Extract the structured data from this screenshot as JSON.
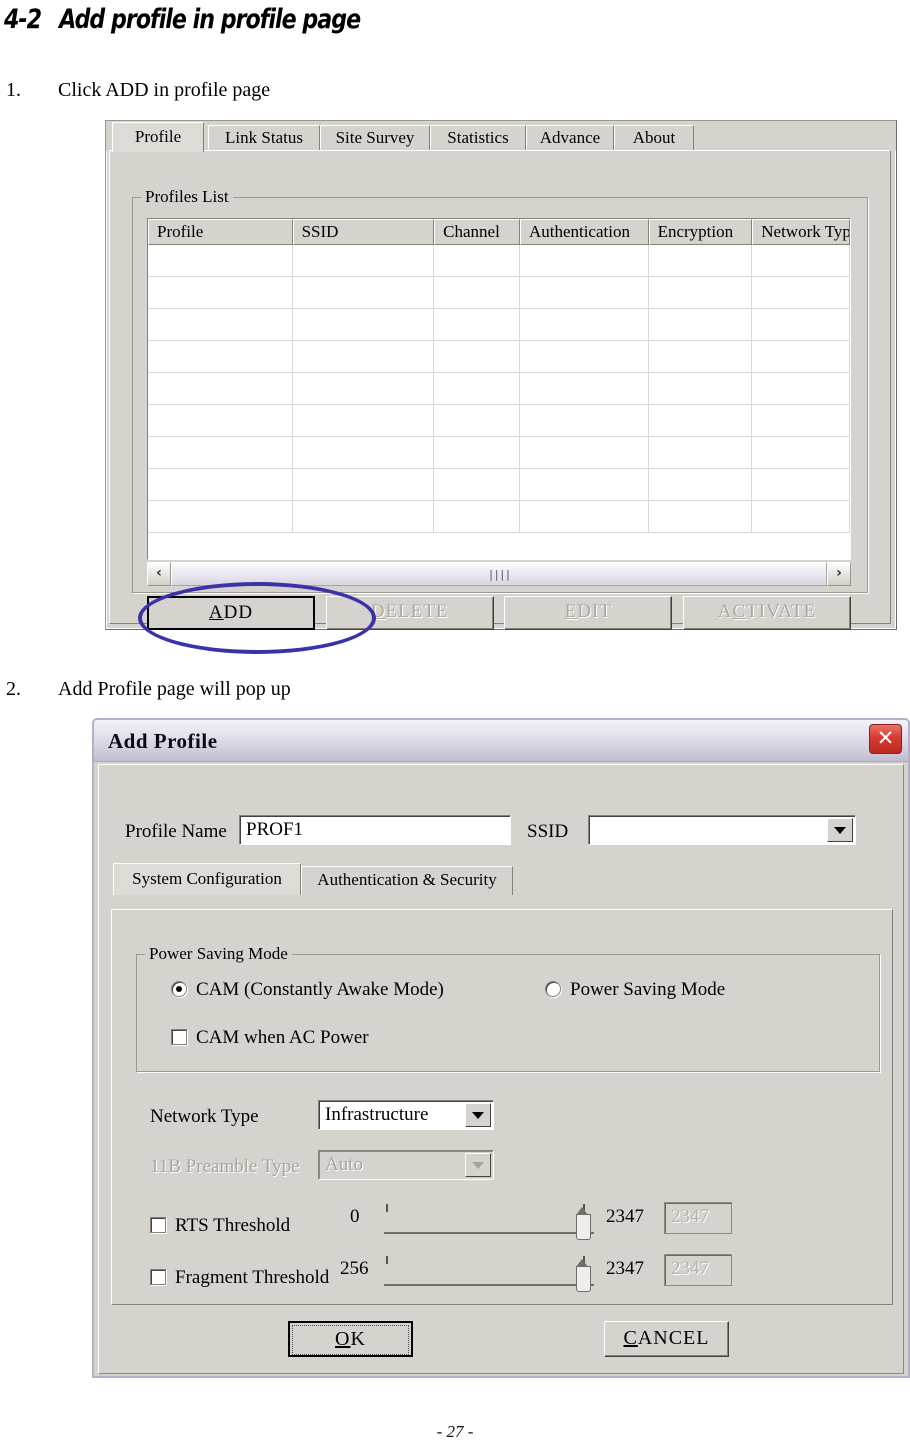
{
  "document": {
    "section_number": "4-2",
    "section_title": "Add profile in profile page",
    "steps": [
      {
        "num": "1.",
        "text": "Click ADD in profile page"
      },
      {
        "num": "2.",
        "text": "Add Profile page will pop up"
      }
    ],
    "page_footer": "- 27 -"
  },
  "profile_window": {
    "tabs": [
      {
        "label": "Profile",
        "selected": true
      },
      {
        "label": "Link Status",
        "selected": false
      },
      {
        "label": "Site Survey",
        "selected": false
      },
      {
        "label": "Statistics",
        "selected": false
      },
      {
        "label": "Advance",
        "selected": false
      },
      {
        "label": "About",
        "selected": false
      }
    ],
    "group_legend": "Profiles List",
    "table": {
      "columns": [
        "Profile",
        "SSID",
        "Channel",
        "Authentication",
        "Encryption",
        "Network Type"
      ],
      "rows": [],
      "empty_row_count": 9
    },
    "scrollbar": {
      "left_arrow": "‹",
      "right_arrow": "›",
      "thumb_grip": "||||"
    },
    "buttons": [
      {
        "label": "ADD",
        "mnemonic": "A",
        "rest": "DD",
        "enabled": true,
        "default": true,
        "highlighted": true
      },
      {
        "label": "DELETE",
        "mnemonic": "D",
        "rest": "ELETE",
        "enabled": false,
        "default": false,
        "highlighted": false
      },
      {
        "label": "EDIT",
        "mnemonic": "E",
        "rest": "DIT",
        "enabled": false,
        "default": false,
        "highlighted": false
      },
      {
        "label": "ACTIVATE",
        "mnemonic": "C",
        "pre": "A",
        "rest": "TIVATE",
        "enabled": false,
        "default": false,
        "highlighted": false
      }
    ],
    "annotation_color": "#3a32a8"
  },
  "add_profile_dialog": {
    "title": "Add Profile",
    "close_icon": "✕",
    "profile_name": {
      "label": "Profile Name",
      "value": "PROF1"
    },
    "ssid": {
      "label": "SSID",
      "value": ""
    },
    "tabs": [
      {
        "label": "System Configuration",
        "selected": true
      },
      {
        "label": "Authentication & Security",
        "selected": false
      }
    ],
    "power_saving": {
      "legend": "Power Saving Mode",
      "cam_radio": {
        "label": "CAM (Constantly Awake Mode)",
        "checked": true
      },
      "psm_radio": {
        "label": "Power Saving Mode",
        "checked": false
      },
      "cam_ac_checkbox": {
        "label": "CAM when AC Power",
        "checked": false
      }
    },
    "network_type": {
      "label": "Network Type",
      "value": "Infrastructure",
      "enabled": true
    },
    "preamble_type": {
      "label": "11B Preamble Type",
      "value": "Auto",
      "enabled": false
    },
    "rts_threshold": {
      "label": "RTS Threshold",
      "checked": false,
      "min": "0",
      "max": "2347",
      "value": "2347",
      "enabled": false
    },
    "fragment_threshold": {
      "label": "Fragment Threshold",
      "checked": false,
      "min": "256",
      "max": "2347",
      "value": "2347",
      "enabled": false
    },
    "ok_button": {
      "label": "OK",
      "mnemonic": "O",
      "rest": "K"
    },
    "cancel_button": {
      "label": "CANCEL",
      "mnemonic": "C",
      "rest": "ANCEL"
    }
  }
}
